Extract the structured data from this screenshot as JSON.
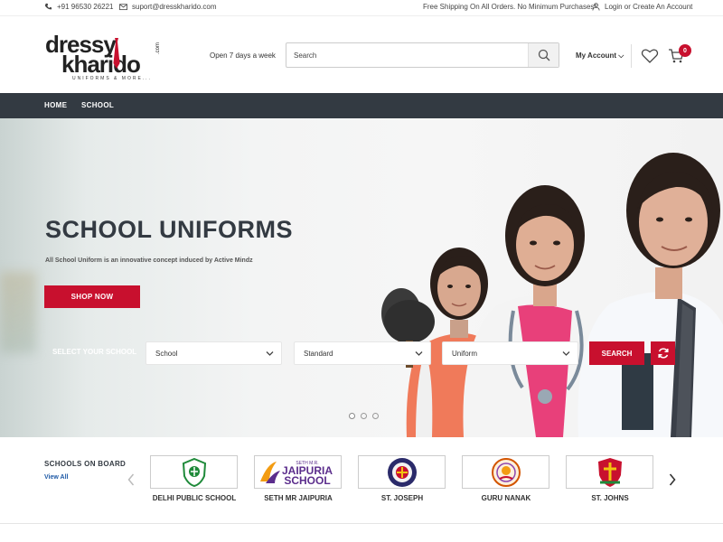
{
  "topbar": {
    "phone": "+91 96530 26221",
    "email": "suport@dresskharido.com",
    "shipping": "Free Shipping On All Orders. No Minimum Purchases*",
    "login": "Login or Create An Account"
  },
  "header": {
    "logo_line1": "dressy",
    "logo_line2": "kharido",
    "logo_suffix": ".com",
    "logo_tagline": "UNIFORMS & MORE...",
    "open_hours": "Open 7 days a week",
    "search_placeholder": "Search",
    "my_account": "My Account ⌵",
    "cart_count": "0"
  },
  "nav": {
    "items": [
      "HOME",
      "SCHOOL"
    ]
  },
  "hero": {
    "title": "SCHOOL UNIFORMS",
    "subtitle": "All School Uniform is an innovative concept induced by Active Mindz",
    "cta": "SHOP NOW",
    "select_label": "SELECT YOUR SCHOOL",
    "selects": [
      "School",
      "Standard",
      "Uniform"
    ],
    "search_btn": "SEARCH",
    "slides": 3,
    "active_slide": 1
  },
  "schools": {
    "title": "SCHOOLS ON BOARD",
    "view_all": "View All",
    "logo_text_jaipuria": {
      "top": "SETH M.R.",
      "l1": "JAIPURIA",
      "l2": "SCHOOL"
    },
    "items": [
      "DELHI PUBLIC SCHOOL",
      "SETH MR JAIPURIA",
      "ST. JOSEPH",
      "GURU NANAK",
      "ST. JOHNS"
    ]
  },
  "colors": {
    "accent": "#c8102e",
    "nav": "#333a42",
    "link": "#1f5aa6"
  }
}
